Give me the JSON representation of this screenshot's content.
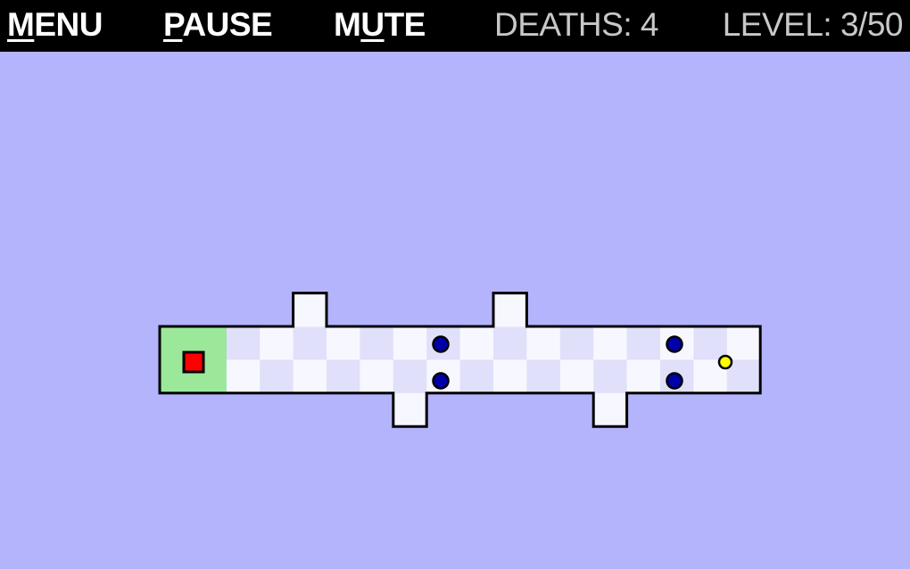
{
  "topbar": {
    "menu": {
      "prefix": "",
      "key": "M",
      "rest": "ENU"
    },
    "pause": {
      "prefix": "",
      "key": "P",
      "rest": "AUSE"
    },
    "mute": {
      "prefix": "M",
      "key": "U",
      "rest": "TE"
    },
    "deaths_label": "DEATHS:",
    "deaths_value": "4",
    "level_label": "LEVEL:",
    "level_value": "3/50"
  },
  "game": {
    "colors": {
      "background": "#b4b4fd",
      "tile_light": "#f7f7ff",
      "tile_dark": "#e0e0fb",
      "safe_zone": "#9be89b",
      "wall": "#000000",
      "player": "#ff0000",
      "enemy": "#0000aa",
      "coin": "#ffff00"
    },
    "entities": [
      "player",
      "enemy",
      "enemy",
      "enemy",
      "enemy",
      "coin"
    ]
  }
}
